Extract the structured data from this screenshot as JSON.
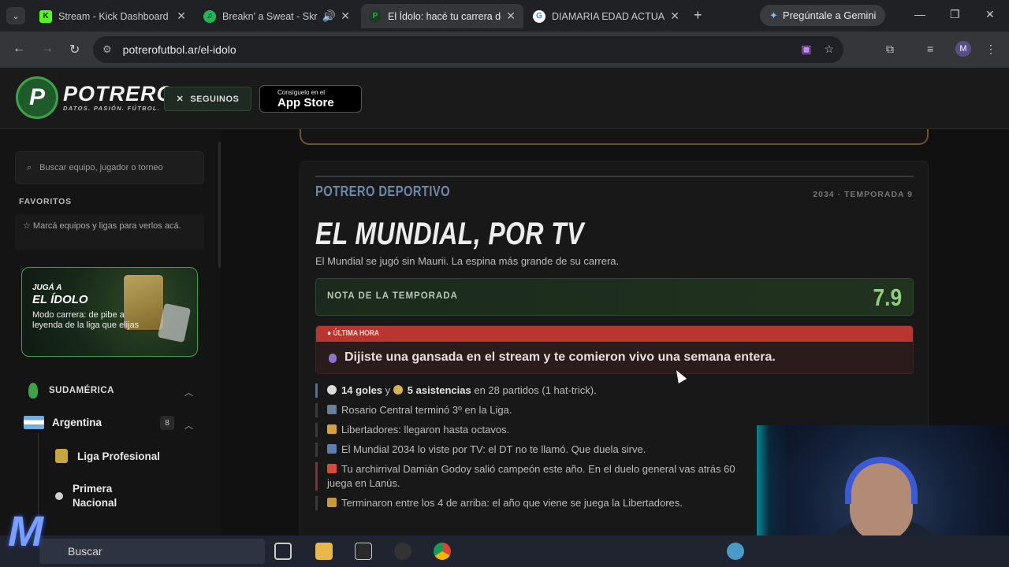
{
  "browser": {
    "tabs": [
      {
        "label": "Stream - Kick Dashboard",
        "fav": "K",
        "fav_color": "#53fc18"
      },
      {
        "label": "Breakn' a Sweat - Skrill",
        "fav": "♫",
        "fav_color": "#1db954"
      },
      {
        "label": "El Ídolo: hacé tu carrera de",
        "fav": "P",
        "fav_color": "#3ea24a"
      },
      {
        "label": "DIAMARIA EDAD ACTUAL",
        "fav": "G",
        "fav_color": "#4285f4"
      }
    ],
    "gemini_label": "Pregúntale a Gemini",
    "url": "potrerofutbol.ar/el-idolo",
    "profile_initial": "M"
  },
  "header": {
    "logo_text": "POTRERO",
    "logo_tagline": "DATOS. PASIÓN. FÚTBOL.",
    "follow_label": "SEGUINOS",
    "appstore_small": "Consíguelo en el",
    "appstore_big": "App Store"
  },
  "sidebar": {
    "search_placeholder": "Buscar equipo, jugador o torneo",
    "favorites_title": "FAVORITOS",
    "favorites_hint": "Marcá equipos y ligas para verlos acá.",
    "promo": {
      "line1": "JUGÁ A",
      "line2": "EL ÍDOLO",
      "line3": "Modo carrera: de pibe a leyenda de la liga que elijas"
    },
    "region": "SUDAMÉRICA",
    "country": "Argentina",
    "country_count": "8",
    "leagues": [
      "Liga Profesional",
      "Primera Nacional"
    ]
  },
  "article": {
    "kicker": "POTRERO DEPORTIVO",
    "season": "2034 · TEMPORADA 9",
    "headline": "EL MUNDIAL, POR TV",
    "subhead": "El Mundial se jugó sin Maurii. La espina más grande de su carrera.",
    "rating_label": "NOTA DE LA TEMPORADA",
    "rating_value": "7.9",
    "breaking_tag": "● ÚLTIMA HORA",
    "breaking_text": "Dijiste una gansada en el stream y te comieron vivo una semana entera.",
    "facts": {
      "goals": "14 goles",
      "y": "y",
      "assists": "5 asistencias",
      "games": "en 28 partidos (1 hat-trick).",
      "f2": "Rosario Central terminó 3º en la Liga.",
      "f3": "Libertadores: llegaron hasta octavos.",
      "f4": "El Mundial 2034 lo viste por TV: el DT no te llamó. Que duela sirve.",
      "f5": "Tu archirrival Damián Godoy salió campeón este año. En el duelo general vas atrás 60",
      "f5b": "juega en Lanús.",
      "f6": "Terminaron entre los 4 de arriba: el año que viene se juega la Libertadores."
    }
  },
  "taskbar": {
    "search_label": "Buscar"
  }
}
